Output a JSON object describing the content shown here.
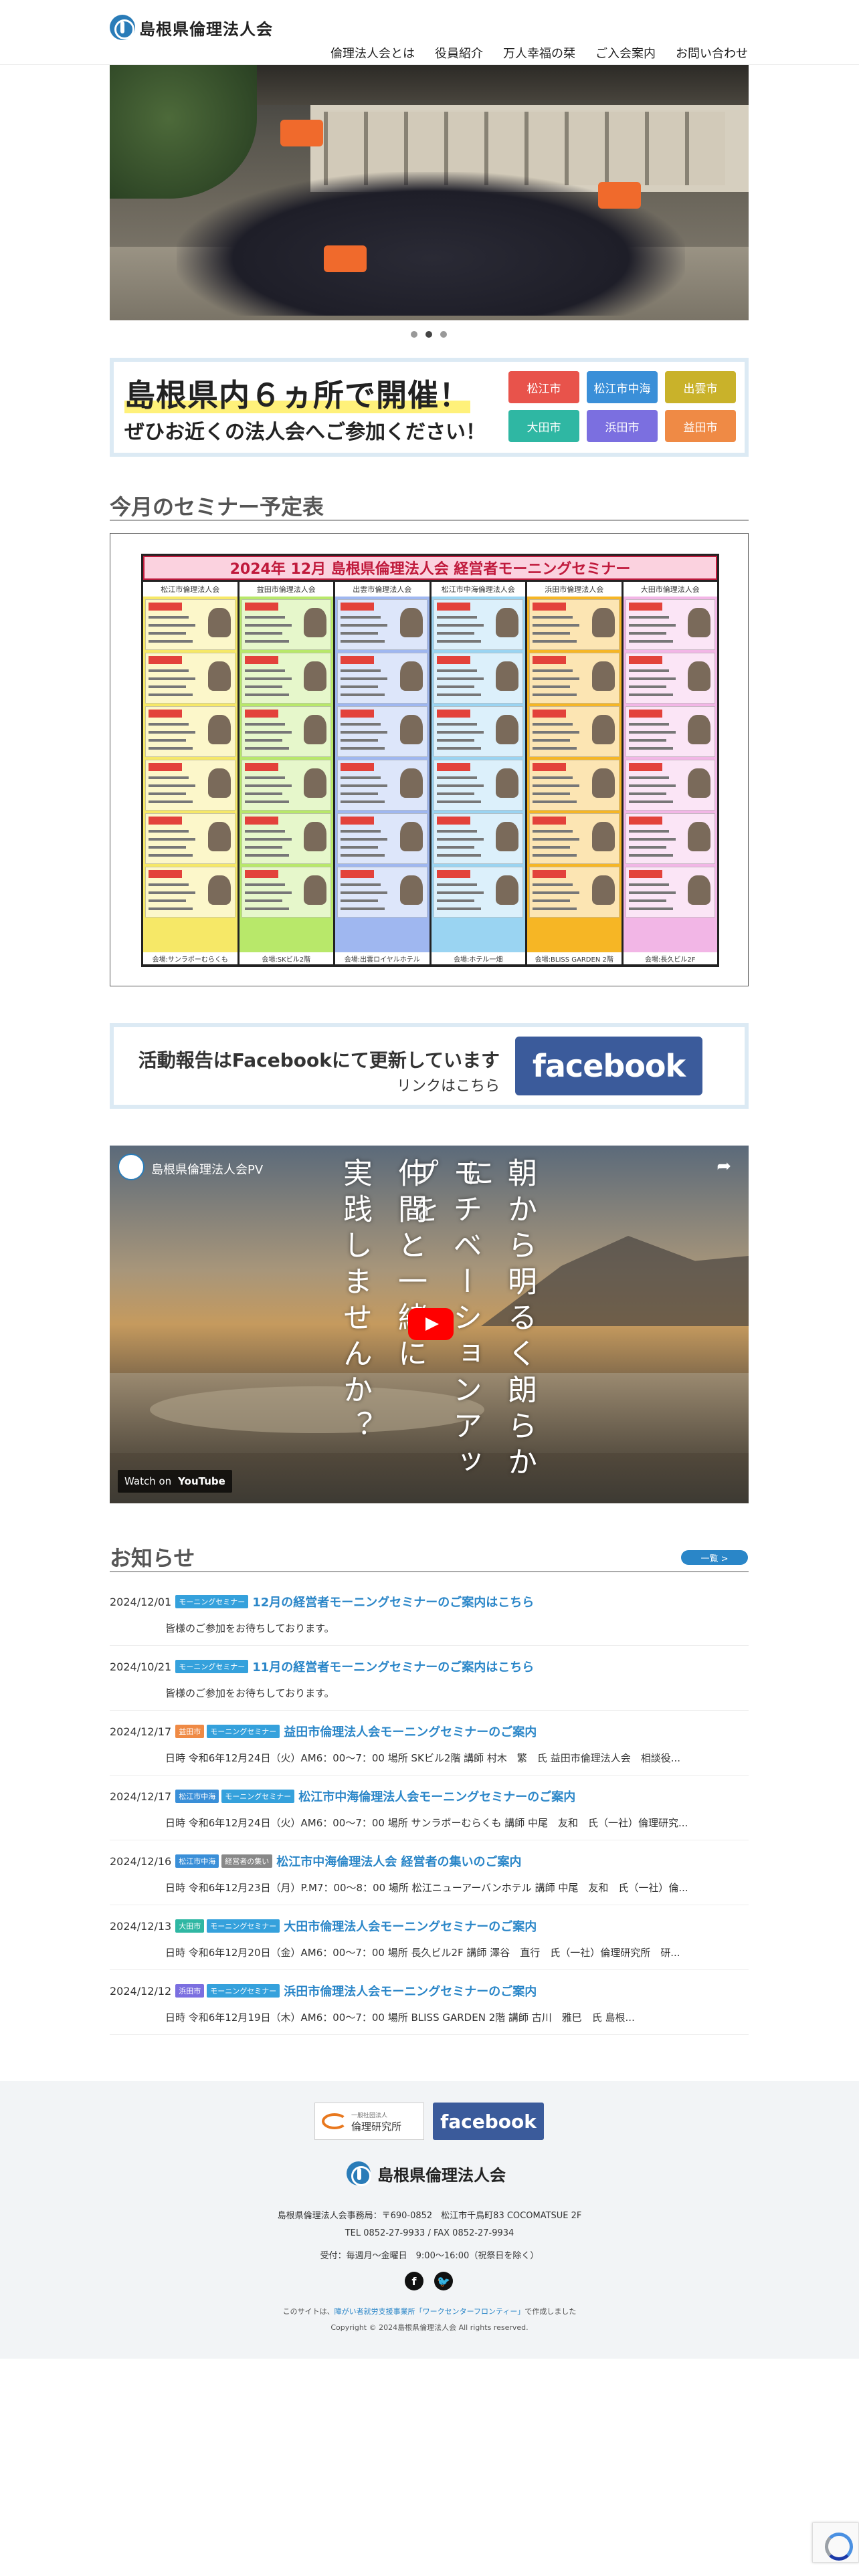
{
  "header": {
    "logo_text": "島根県倫理法人会",
    "nav": [
      "倫理法人会とは",
      "役員紹介",
      "万人幸福の栞",
      "ご入会案内",
      "お問い合わせ"
    ]
  },
  "hero": {
    "slides_total": 3,
    "active_slide": 2
  },
  "venue": {
    "title": "島根県内６ヵ所で開催！",
    "subtitle": "ぜひお近くの法人会へご参加ください！",
    "cities": [
      {
        "label": "松江市",
        "color": "#e8534b"
      },
      {
        "label": "松江市中海",
        "color": "#3a8fd8"
      },
      {
        "label": "出雲市",
        "color": "#c9b22a"
      },
      {
        "label": "大田市",
        "color": "#2fb7a3"
      },
      {
        "label": "浜田市",
        "color": "#7b6fe0"
      },
      {
        "label": "益田市",
        "color": "#ef8a45"
      }
    ]
  },
  "seminar": {
    "section_title": "今月のセミナー予定表",
    "schedule_heading": "2024年 12月 島根県倫理法人会 経営者モーニングセミナー",
    "columns": [
      {
        "title": "松江市倫理法人会",
        "color": "#f6e867",
        "venue": "会場:サンラポーむらくも"
      },
      {
        "title": "益田市倫理法人会",
        "color": "#b8e86a",
        "venue": "会場:SKビル2階"
      },
      {
        "title": "出雲市倫理法人会",
        "color": "#9fb7f0",
        "venue": "会場:出雲ロイヤルホテル"
      },
      {
        "title": "松江市中海倫理法人会",
        "color": "#9ad4f2",
        "venue": "会場:ホテル一畑"
      },
      {
        "title": "浜田市倫理法人会",
        "color": "#f6b625",
        "venue": "会場:BLISS GARDEN 2階"
      },
      {
        "title": "大田市倫理法人会",
        "color": "#f2b6e6",
        "venue": "会場:長久ビル2F"
      }
    ]
  },
  "facebook_banner": {
    "line1": "活動報告はFacebookにて更新しています",
    "line2": "リンクはこちら",
    "logo": "facebook"
  },
  "video": {
    "channel_title": "島根県倫理法人会PV",
    "lines": [
      "朝から明るく朗らかに",
      "モチベーションアップを",
      "仲間と一緒に",
      "実践しませんか？"
    ],
    "watch_on": "Watch on",
    "youtube": "YouTube"
  },
  "news": {
    "section_title": "お知らせ",
    "more_label": "一覧 >",
    "items": [
      {
        "date": "2024/12/01",
        "badges": [
          {
            "label": "モーニングセミナー",
            "color": "#35a1dc"
          }
        ],
        "title": "12月の経営者モーニングセミナーのご案内はこちら",
        "body": "皆様のご参加をお待ちしております。"
      },
      {
        "date": "2024/10/21",
        "badges": [
          {
            "label": "モーニングセミナー",
            "color": "#35a1dc"
          }
        ],
        "title": "11月の経営者モーニングセミナーのご案内はこちら",
        "body": "皆様のご参加をお待ちしております。"
      },
      {
        "date": "2024/12/17",
        "badges": [
          {
            "label": "益田市",
            "color": "#ef8a45"
          },
          {
            "label": "モーニングセミナー",
            "color": "#35a1dc"
          }
        ],
        "title": "益田市倫理法人会モーニングセミナーのご案内",
        "body": "日時 令和6年12月24日（火）AM6：00〜7：00 場所 SKビル2階 講師 村木　繁　氏 益田市倫理法人会　相談役..."
      },
      {
        "date": "2024/12/17",
        "badges": [
          {
            "label": "松江市中海",
            "color": "#3a8fd8"
          },
          {
            "label": "モーニングセミナー",
            "color": "#35a1dc"
          }
        ],
        "title": "松江市中海倫理法人会モーニングセミナーのご案内",
        "body": "日時 令和6年12月24日（火）AM6：00〜7：00 場所 サンラポーむらくも 講師 中尾　友和　氏（一社）倫理研究..."
      },
      {
        "date": "2024/12/16",
        "badges": [
          {
            "label": "松江市中海",
            "color": "#3a8fd8"
          },
          {
            "label": "経営者の集い",
            "color": "#888888"
          }
        ],
        "title": "松江市中海倫理法人会 経営者の集いのご案内",
        "body": "日時 令和6年12月23日（月）P.M7：00〜8：00 場所 松江ニューアーバンホテル 講師 中尾　友和　氏（一社）倫..."
      },
      {
        "date": "2024/12/13",
        "badges": [
          {
            "label": "大田市",
            "color": "#2fb7a3"
          },
          {
            "label": "モーニングセミナー",
            "color": "#35a1dc"
          }
        ],
        "title": "大田市倫理法人会モーニングセミナーのご案内",
        "body": "日時 令和6年12月20日（金）AM6：00〜7：00 場所 長久ビル2F 講師 澤谷　直行　氏（一社）倫理研究所　研..."
      },
      {
        "date": "2024/12/12",
        "badges": [
          {
            "label": "浜田市",
            "color": "#7b6fe0"
          },
          {
            "label": "モーニングセミナー",
            "color": "#35a1dc"
          }
        ],
        "title": "浜田市倫理法人会モーニングセミナーのご案内",
        "body": "日時 令和6年12月19日（木）AM6：00〜7：00 場所 BLISS GARDEN 2階 講師 古川　雅巳　氏 島根..."
      }
    ]
  },
  "footer": {
    "rinri_small": "一般社団法人",
    "rinri_name": "倫理研究所",
    "facebook": "facebook",
    "logo_text": "島根県倫理法人会",
    "address": "島根県倫理法人会事務局：〒690-0852　松江市千鳥町83 COCOMATSUE 2F",
    "tel": "TEL 0852-27-9933 / FAX 0852-27-9934",
    "hours": "受付：毎週月〜金曜日　9:00〜16:00（祝祭日を除く）",
    "credit_prefix": "このサイトは、",
    "credit_link": "障がい者就労支援事業所「ワークセンターフロンティー」",
    "credit_suffix": "で作成しました",
    "copyright": "Copyright © 2024島根県倫理法人会 All rights reserved."
  }
}
